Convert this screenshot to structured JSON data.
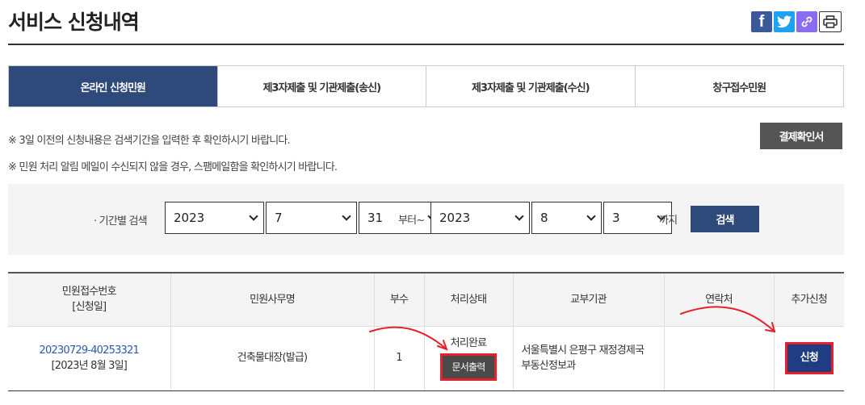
{
  "header": {
    "title": "서비스 신청내역",
    "share_icons": [
      "facebook-icon",
      "twitter-icon",
      "link-icon",
      "print-icon"
    ],
    "fb_glyph": "f"
  },
  "tabs": [
    {
      "label": "온라인 신청민원",
      "active": true
    },
    {
      "label": "제3자제출 및 기관제출(송신)",
      "active": false
    },
    {
      "label": "제3자제출 및 기관제출(수신)",
      "active": false
    },
    {
      "label": "창구접수민원",
      "active": false
    }
  ],
  "notices": [
    "※ 3일 이전의 신청내용은 검색기간을 입력한 후 확인하시기 바랍니다.",
    "※ 민원 처리 알림 메일이 수신되지 않을 경우, 스팸메일함을 확인하시기 바랍니다."
  ],
  "payment_receipt_label": "결제확인서",
  "search": {
    "label": "· 기간별 검색",
    "from_year": "2023",
    "from_month": "7",
    "from_day": "31",
    "from_text": "부터~",
    "to_year": "2023",
    "to_month": "8",
    "to_day": "3",
    "to_text": "까지",
    "button_label": "검색"
  },
  "table": {
    "headers": {
      "receipt_no": "민원접수번호",
      "apply_date": "[신청일]",
      "name": "민원사무명",
      "copies": "부수",
      "status": "처리상태",
      "agency": "교부기관",
      "contact": "연락처",
      "additional": "추가신청"
    },
    "rows": [
      {
        "receipt_no": "20230729-40253321",
        "apply_date": "[2023년 8월 3일]",
        "name": "건축물대장(발급)",
        "copies": "1",
        "status": "처리완료",
        "print_label": "문서출력",
        "agency_line1": "서울특별시 은평구 재정경제국",
        "agency_line2": "부동산정보과",
        "contact": "",
        "apply_label": "신청"
      }
    ]
  },
  "colors": {
    "primary": "#2e4a7a",
    "highlight": "#e8202a",
    "facebook": "#3b5998",
    "twitter": "#1da1f2"
  }
}
